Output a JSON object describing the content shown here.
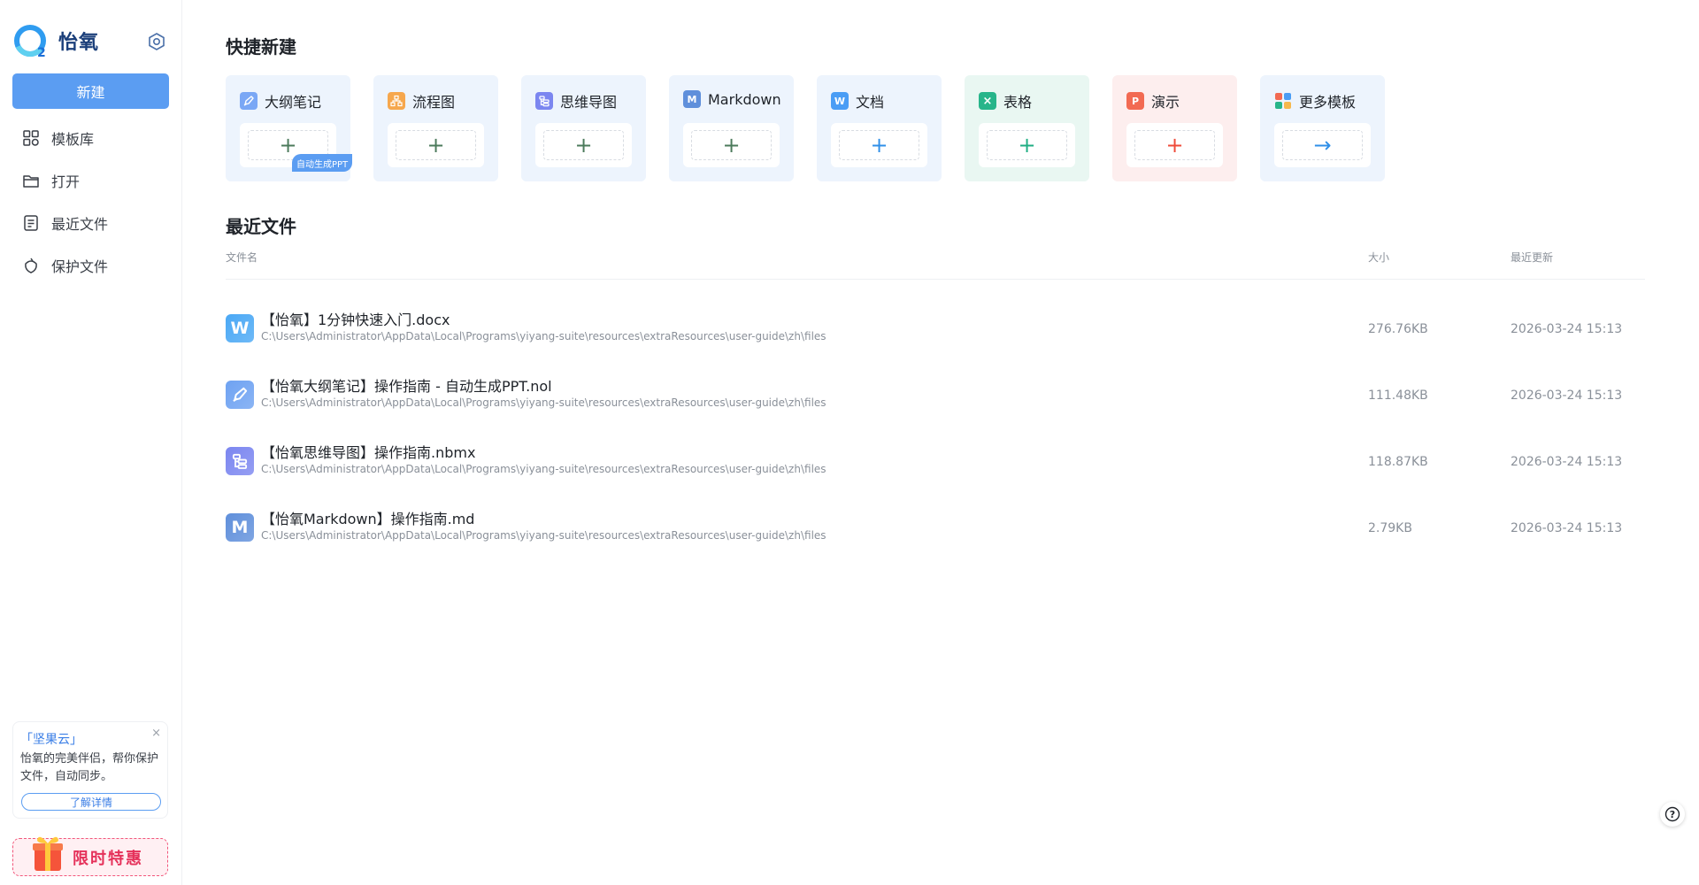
{
  "app": {
    "name": "怡氧"
  },
  "sidebar": {
    "new_label": "新建",
    "nav": [
      {
        "label": "模板库",
        "icon": "template-grid-icon"
      },
      {
        "label": "打开",
        "icon": "folder-open-icon"
      },
      {
        "label": "最近文件",
        "icon": "recent-document-icon"
      },
      {
        "label": "保护文件",
        "icon": "protect-file-icon"
      }
    ],
    "promo": {
      "title": "「坚果云」",
      "desc": "怡氧的完美伴侣，帮你保护文件，自动同步。",
      "button": "了解详情",
      "close": "×"
    },
    "offer_label": "限时特惠"
  },
  "quick_create": {
    "title": "快捷新建",
    "badge": "自动生成PPT",
    "items": [
      {
        "label": "大纲笔记",
        "icon": "outline-note-icon",
        "icon_color": "#7aa7f5",
        "bg": "#edf4fd",
        "action_symbol": "+",
        "action_color": "#4b7a5b"
      },
      {
        "label": "流程图",
        "icon": "flowchart-icon",
        "icon_color": "#f6a74d",
        "bg": "#edf4fd",
        "action_symbol": "+",
        "action_color": "#4b7a5b"
      },
      {
        "label": "思维导图",
        "icon": "mindmap-icon",
        "icon_color": "#7b86f0",
        "bg": "#edf4fd",
        "action_symbol": "+",
        "action_color": "#4b7a5b"
      },
      {
        "label": "Markdown",
        "icon": "markdown-icon",
        "icon_color": "#5f8fdb",
        "bg": "#edf4fd",
        "action_symbol": "+",
        "action_color": "#4b7a5b"
      },
      {
        "label": "文档",
        "icon": "word-doc-icon",
        "icon_color": "#4a9df5",
        "bg": "#edf4fd",
        "action_symbol": "+",
        "action_color": "#2f8fe8"
      },
      {
        "label": "表格",
        "icon": "spreadsheet-icon",
        "icon_color": "#27b58a",
        "bg": "#e9f7f2",
        "action_symbol": "+",
        "action_color": "#1fae83"
      },
      {
        "label": "演示",
        "icon": "presentation-icon",
        "icon_color": "#f26a52",
        "bg": "#fdeeee",
        "action_symbol": "+",
        "action_color": "#ef4b3a"
      },
      {
        "label": "更多模板",
        "icon": "more-templates-icon",
        "icon_color": "#f0a040",
        "bg": "#edf4fd",
        "action_symbol": "→",
        "action_color": "#2f8fe8"
      }
    ]
  },
  "recent": {
    "title": "最近文件",
    "columns": {
      "name": "文件名",
      "size": "大小",
      "updated": "最近更新"
    },
    "files": [
      {
        "name": "【怡氧】1分钟快速入门.docx",
        "path": "C:\\Users\\Administrator\\AppData\\Local\\Programs\\yiyang-suite\\resources\\extraResources\\user-guide\\zh\\files",
        "size": "276.76KB",
        "updated": "2026-03-24 15:13",
        "icon": "word-file-icon",
        "icon_text": "W",
        "icon_color": "#4aa8f5"
      },
      {
        "name": "【怡氧大纲笔记】操作指南 - 自动生成PPT.nol",
        "path": "C:\\Users\\Administrator\\AppData\\Local\\Programs\\yiyang-suite\\resources\\extraResources\\user-guide\\zh\\files",
        "size": "111.48KB",
        "updated": "2026-03-24 15:13",
        "icon": "outline-note-file-icon",
        "icon_text": "",
        "icon_color": "#6ea2f2"
      },
      {
        "name": "【怡氧思维导图】操作指南.nbmx",
        "path": "C:\\Users\\Administrator\\AppData\\Local\\Programs\\yiyang-suite\\resources\\extraResources\\user-guide\\zh\\files",
        "size": "118.87KB",
        "updated": "2026-03-24 15:13",
        "icon": "mindmap-file-icon",
        "icon_text": "",
        "icon_color": "#7b86f0"
      },
      {
        "name": "【怡氧Markdown】操作指南.md",
        "path": "C:\\Users\\Administrator\\AppData\\Local\\Programs\\yiyang-suite\\resources\\extraResources\\user-guide\\zh\\files",
        "size": "2.79KB",
        "updated": "2026-03-24 15:13",
        "icon": "markdown-file-icon",
        "icon_text": "M",
        "icon_color": "#5f8fdb"
      }
    ]
  },
  "help": {
    "label": "?"
  }
}
